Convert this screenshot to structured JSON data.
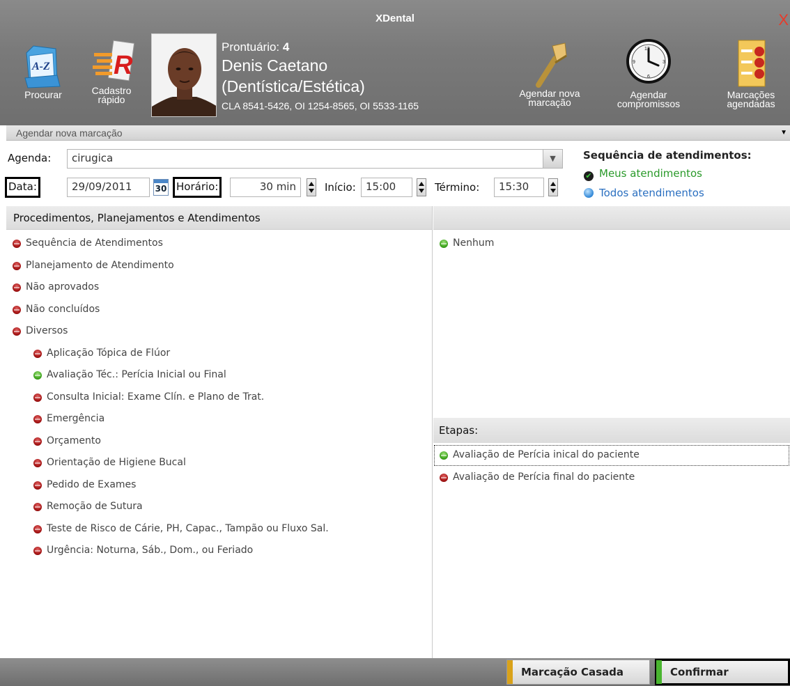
{
  "window": {
    "title": "XDental",
    "close_glyph": "X"
  },
  "toolbar": {
    "procurar": "Procurar",
    "cadastro_line1": "Cadastro",
    "cadastro_line2": "rápido",
    "agendar_nova_line1": "Agendar nova",
    "agendar_nova_line2": "marcação",
    "agendar_comp_line1": "Agendar",
    "agendar_comp_line2": "compromissos",
    "marcacoes_line1": "Marcações",
    "marcacoes_line2": "agendadas"
  },
  "patient": {
    "prontuario_label": "Prontuário:",
    "prontuario_value": "4",
    "name": "Denis Caetano",
    "specialty": "(Dentística/Estética)",
    "phones": "CLA 8541-5426, OI 1254-8565, OI 5533-1165"
  },
  "subbar": {
    "label": "Agendar nova marcação"
  },
  "form": {
    "agenda_label": "Agenda:",
    "agenda_value": "cirugica",
    "data_label": "Data:",
    "data_value": "29/09/2011",
    "calendar_day": "30",
    "horario_label": "Horário:",
    "horario_value": "30 min",
    "inicio_label": "Início:",
    "inicio_value": "15:00",
    "termino_label": "Término:",
    "termino_value": "15:30"
  },
  "sequencia": {
    "title": "Sequência de atendimentos:",
    "meus": "Meus atendimentos",
    "todos": "Todos atendimentos",
    "colors": {
      "meus": "#2a9a2a",
      "todos": "#2a6fc0"
    }
  },
  "left_panel": {
    "header": "Procedimentos, Planejamentos e Atendimentos",
    "top_items": [
      {
        "label": "Sequência de Atendimentos",
        "status": "red"
      },
      {
        "label": "Planejamento de Atendimento",
        "status": "red"
      },
      {
        "label": "Não aprovados",
        "status": "red"
      },
      {
        "label": "Não concluídos",
        "status": "red"
      },
      {
        "label": "Diversos",
        "status": "red"
      }
    ],
    "sub_items": [
      {
        "label": "Aplicação Tópica de Flúor",
        "status": "red"
      },
      {
        "label": "Avaliação Téc.: Perícia Inicial ou Final",
        "status": "green"
      },
      {
        "label": "Consulta Inicial: Exame Clín. e Plano de Trat.",
        "status": "red"
      },
      {
        "label": "Emergência",
        "status": "red"
      },
      {
        "label": "Orçamento",
        "status": "red"
      },
      {
        "label": "Orientação de Higiene Bucal",
        "status": "red"
      },
      {
        "label": "Pedido de Exames",
        "status": "red"
      },
      {
        "label": "Remoção de Sutura",
        "status": "red"
      },
      {
        "label": "Teste de Risco de Cárie, PH, Capac., Tampão ou Fluxo Sal.",
        "status": "red"
      },
      {
        "label": "Urgência: Noturna, Sáb., Dom., ou Feriado",
        "status": "red"
      }
    ]
  },
  "right_panel": {
    "items": [
      {
        "label": "Nenhum",
        "status": "green"
      }
    ],
    "etapas_header": "Etapas:",
    "etapas": [
      {
        "label": "Avaliação de Perícia inical do paciente",
        "status": "green"
      },
      {
        "label": "Avaliação de Perícia final do paciente",
        "status": "red"
      }
    ]
  },
  "footer": {
    "marcacao_casada": "Marcação Casada",
    "confirmar": "Confirmar",
    "colors": {
      "marcacao_strip": "#d9a21a",
      "confirmar_strip": "#49b52f"
    }
  }
}
